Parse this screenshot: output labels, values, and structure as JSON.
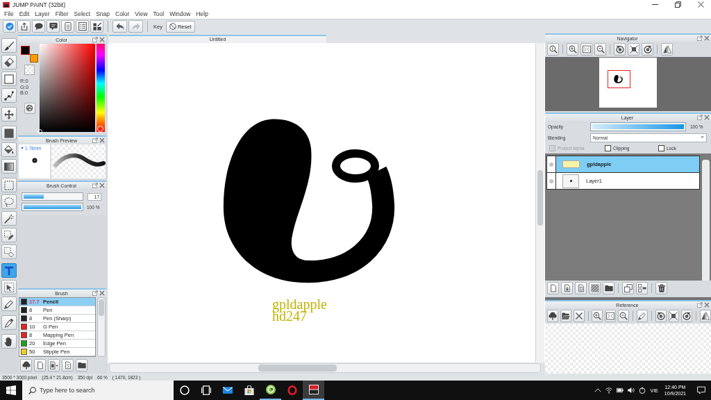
{
  "window": {
    "title": "JUMP PAINT (32bit)"
  },
  "menu": [
    "File",
    "Edit",
    "Layer",
    "Filter",
    "Select",
    "Snap",
    "Color",
    "View",
    "Tool",
    "Window",
    "Help"
  ],
  "toolbar": {
    "history": [
      {
        "kind": "undo",
        "disabled": false
      },
      {
        "kind": "redo",
        "disabled": true
      }
    ],
    "key_label": "Key",
    "reset_button": "Reset"
  },
  "tools": [
    {
      "selected": false
    },
    {
      "selected": false
    },
    {
      "selected": false
    },
    {
      "selected": false
    },
    {
      "selected": false
    },
    {
      "selected": false
    },
    {
      "selected": false
    },
    {
      "selected": false
    },
    {
      "selected": false
    },
    {
      "selected": false
    },
    {
      "selected": false
    },
    {
      "selected": false
    },
    {
      "selected": false
    },
    {
      "selected": true
    },
    {
      "selected": false
    },
    {
      "selected": false
    },
    {
      "selected": false
    },
    {
      "selected": false
    }
  ],
  "color_panel": {
    "title": "Color",
    "swatches": [
      {
        "kind": "foreground",
        "color": "#000000"
      },
      {
        "kind": "background",
        "color": "#ff9900"
      }
    ],
    "readout": [
      "R:0",
      "G:0",
      "B:0"
    ],
    "hue_slider": {
      "level": 0
    }
  },
  "brush_preview": {
    "title": "Brush Preview",
    "size": "1.78mm"
  },
  "brush_control": {
    "title": "Brush Control",
    "sliders": [
      {
        "kind": "number",
        "level": 0.35,
        "reading": "17"
      },
      {
        "kind": "text",
        "level": 1,
        "reading": "100 %"
      }
    ]
  },
  "brush_panel": {
    "title": "Brush",
    "items": [
      {
        "size": "17.7",
        "name": "Pencil",
        "color": "#222222",
        "selected": true
      },
      {
        "size": "8",
        "name": "Pen",
        "color": "#222222",
        "selected": false
      },
      {
        "size": "8",
        "name": "Pen (Sharp)",
        "color": "#222222",
        "selected": false
      },
      {
        "size": "10",
        "name": "G Pen",
        "color": "#e52420",
        "selected": false
      },
      {
        "size": "8",
        "name": "Mapping Pen",
        "color": "#e52420",
        "selected": false
      },
      {
        "size": "20",
        "name": "Edge Pen",
        "color": "#1aa51a",
        "selected": false
      },
      {
        "size": "50",
        "name": "Stipple Pen",
        "color": "#e8d21a",
        "selected": false
      }
    ]
  },
  "canvas": {
    "tab": "Untitled",
    "signature": [
      "gpldapple",
      "hd247"
    ]
  },
  "navigator": {
    "title": "Navigator"
  },
  "layer_panel": {
    "title": "Layer",
    "opacity": {
      "label": "Opacity",
      "level": 1,
      "reading": "100 %"
    },
    "blending": {
      "label": "Blending",
      "value": "Normal"
    },
    "options": [
      {
        "label": "Protect Alpha",
        "checked": false,
        "disabled": true
      },
      {
        "label": "Clipping",
        "checked": false,
        "disabled": false
      },
      {
        "label": "Lock",
        "checked": false,
        "disabled": false
      }
    ],
    "layers": [
      {
        "name": "gpldapple",
        "kind": "text",
        "selected": true
      },
      {
        "name": "Layer1",
        "kind": "raster",
        "selected": false
      }
    ]
  },
  "reference_panel": {
    "title": "Reference"
  },
  "status_bar": [
    "3500 * 3000 pixel",
    "(25.4 * 21.8cm)",
    "350 dpi",
    "66 %",
    "( 1470, 1823 )"
  ],
  "taskbar": {
    "search": {
      "placeholder": "Type here to search"
    },
    "apps": [
      {
        "selected": false,
        "running": false
      },
      {
        "selected": false,
        "running": false
      },
      {
        "selected": false,
        "running": true
      },
      {
        "selected": false,
        "running": false
      },
      {
        "selected": true,
        "running": true
      }
    ],
    "language": "VIE",
    "time": "12:40 PM",
    "date": "10/9/2021"
  }
}
